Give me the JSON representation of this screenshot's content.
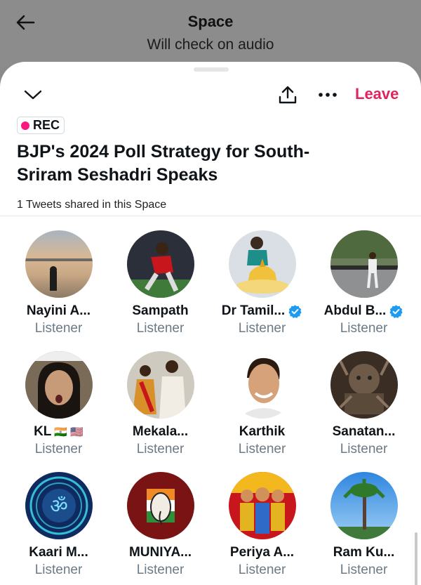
{
  "header": {
    "title": "Space",
    "back_icon": "arrow-left-icon",
    "underlying_text": "Will check on audio"
  },
  "sheet": {
    "collapse_icon": "chevron-down-icon",
    "share_icon": "share-icon",
    "more_icon": "more-dots-icon",
    "leave_label": "Leave",
    "rec_label": "REC",
    "title_line1": "BJP's 2024 Poll Strategy for South-",
    "title_line2": "Sriram Seshadri Speaks",
    "tweets_shared": "1 Tweets shared in this Space"
  },
  "colors": {
    "leave": "#e0245e",
    "rec_dot": "#f91880",
    "verified": "#1d9bf0",
    "role_text": "#6b7a86"
  },
  "participants": [
    {
      "name": "Nayini A...",
      "role": "Listener",
      "verified": false
    },
    {
      "name": "Sampath",
      "role": "Listener",
      "verified": false
    },
    {
      "name": "Dr Tamil...",
      "role": "Listener",
      "verified": true
    },
    {
      "name": "Abdul B...",
      "role": "Listener",
      "verified": true
    },
    {
      "name": "KL",
      "flags": "🇮🇳 🇺🇸",
      "role": "Listener",
      "verified": false
    },
    {
      "name": "Mekala...",
      "role": "Listener",
      "verified": false
    },
    {
      "name": "Karthik",
      "role": "Listener",
      "verified": false
    },
    {
      "name": "Sanatan...",
      "role": "Listener",
      "verified": false
    },
    {
      "name": "Kaari M...",
      "role": "Listener",
      "verified": false
    },
    {
      "name": "MUNIYA...",
      "role": "Listener",
      "verified": false
    },
    {
      "name": "Periya A...",
      "role": "Listener",
      "verified": false
    },
    {
      "name": "Ram Ku...",
      "role": "Listener",
      "verified": false
    }
  ]
}
